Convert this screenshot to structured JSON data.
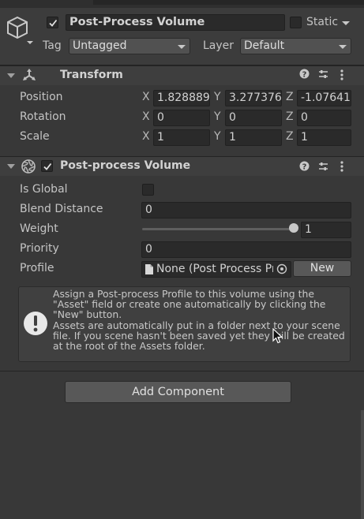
{
  "header": {
    "active": true,
    "object_name": "Post-Process Volume",
    "static_label": "Static",
    "static_checked": false,
    "tag_label": "Tag",
    "tag_value": "Untagged",
    "layer_label": "Layer",
    "layer_value": "Default"
  },
  "transform": {
    "title": "Transform",
    "rows": [
      {
        "label": "Position",
        "x": "1.828889",
        "y": "3.277376",
        "z": "-1.07641"
      },
      {
        "label": "Rotation",
        "x": "0",
        "y": "0",
        "z": "0"
      },
      {
        "label": "Scale",
        "x": "1",
        "y": "1",
        "z": "1"
      }
    ],
    "axis_x": "X",
    "axis_y": "Y",
    "axis_z": "Z"
  },
  "volume": {
    "title": "Post-process Volume",
    "enabled": true,
    "is_global_label": "Is Global",
    "is_global": false,
    "blend_distance_label": "Blend Distance",
    "blend_distance": "0",
    "weight_label": "Weight",
    "weight": "1",
    "weight_fraction": 1.0,
    "priority_label": "Priority",
    "priority": "0",
    "profile_label": "Profile",
    "profile_value": "None (Post Process Profile)",
    "new_button": "New",
    "help_text": "Assign a Post-process Profile to this volume using the \"Asset\" field or create one automatically by clicking the \"New\" button.\nAssets are automatically put in a folder next to your scene file. If you scene hasn't been saved yet they will be created at the root of the Assets folder."
  },
  "add_component": "Add Component"
}
